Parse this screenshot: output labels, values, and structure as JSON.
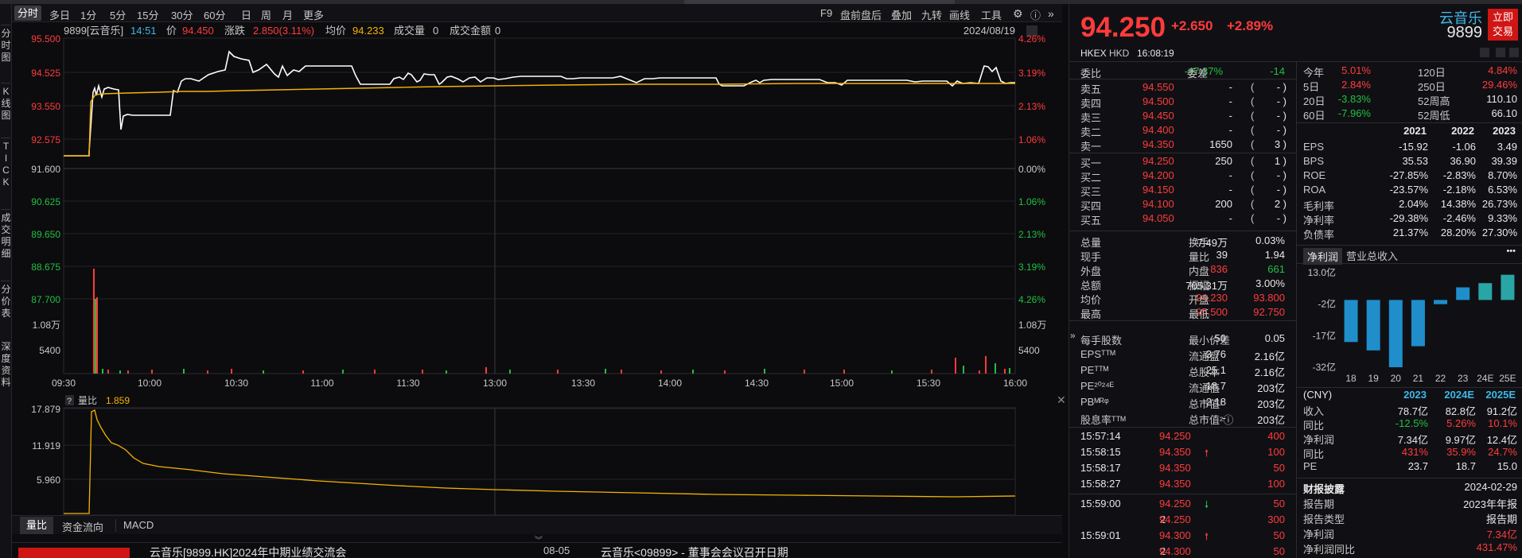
{
  "toolbar": {
    "timeframes": [
      "分时",
      "多日",
      "1分",
      "5分",
      "15分",
      "30分",
      "60分",
      "日",
      "周",
      "月",
      "更多"
    ],
    "right_items": [
      "F9",
      "盘前盘后",
      "叠加",
      "九转",
      "画线",
      "工具"
    ]
  },
  "left_tabs": [
    "分时图",
    "K线图",
    "TICK",
    "成交明细",
    "分价表",
    "深度资料"
  ],
  "chart": {
    "header": {
      "code": "9899[云音乐]",
      "time": "14:51",
      "price_label": "价",
      "price": "94.450",
      "chg_label": "涨跌",
      "chg": "2.850(3.11%)",
      "avg_label": "均价",
      "avg": "94.233",
      "vol_label": "成交量",
      "vol": "0",
      "amt_label": "成交金额",
      "amt": "0",
      "date": "2024/08/19"
    },
    "price_ticks": [
      "95.500",
      "94.525",
      "93.550",
      "92.575",
      "91.600",
      "90.625",
      "89.650",
      "88.675",
      "87.700"
    ],
    "pct_ticks": [
      "4.26%",
      "3.19%",
      "2.13%",
      "1.06%",
      "0.00%",
      "1.06%",
      "2.13%",
      "3.19%",
      "4.26%"
    ],
    "vol_ticks": [
      "1.08万",
      "5400"
    ],
    "time_ticks": [
      "09:30",
      "10:00",
      "10:30",
      "11:00",
      "11:30",
      "13:00",
      "13:30",
      "14:00",
      "14:30",
      "15:00",
      "15:30",
      "16:00"
    ]
  },
  "sub_chart": {
    "label": "量比",
    "value": "1.859",
    "ticks": [
      "17.879",
      "11.919",
      "5.960"
    ]
  },
  "bottom_tabs": [
    "量比",
    "资金流向",
    "MACD"
  ],
  "news": [
    "云音乐[9899.HK]2024年中期业绩交流会",
    "08-05",
    "云音乐<09899> - 董事会会议召开日期"
  ],
  "quote": {
    "name": "云音乐",
    "code": "9899",
    "price": "94.250",
    "change": "+2.650",
    "pct": "+2.89%",
    "exchange": "HKEX",
    "currency": "HKD",
    "time": "16:08:19",
    "trade_button": "立即交易"
  },
  "orderbook": {
    "ratio_label": "委比",
    "ratio": "-47.37%",
    "diff_label": "委差",
    "diff": "-14",
    "asks": [
      {
        "label": "卖五",
        "price": "94.550",
        "vol": "-",
        "n": "-"
      },
      {
        "label": "卖四",
        "price": "94.500",
        "vol": "-",
        "n": "-"
      },
      {
        "label": "卖三",
        "price": "94.450",
        "vol": "-",
        "n": "-"
      },
      {
        "label": "卖二",
        "price": "94.400",
        "vol": "-",
        "n": "-"
      },
      {
        "label": "卖一",
        "price": "94.350",
        "vol": "1650",
        "n": "3"
      }
    ],
    "bids": [
      {
        "label": "买一",
        "price": "94.250",
        "vol": "250",
        "n": "1"
      },
      {
        "label": "买二",
        "price": "94.200",
        "vol": "-",
        "n": "-"
      },
      {
        "label": "买三",
        "price": "94.150",
        "vol": "-",
        "n": "-"
      },
      {
        "label": "买四",
        "price": "94.100",
        "vol": "200",
        "n": "2"
      },
      {
        "label": "买五",
        "price": "94.050",
        "vol": "-",
        "n": "-"
      }
    ]
  },
  "stats": [
    {
      "l1": "总量",
      "v1": "7.49万",
      "c1": "wt",
      "l2": "换手",
      "v2": "0.03%",
      "c2": "wt"
    },
    {
      "l1": "现手",
      "v1": "39",
      "c1": "wt",
      "l2": "量比",
      "v2": "1.94",
      "c2": "wt"
    },
    {
      "l1": "外盘",
      "v1": "836",
      "c1": "up",
      "l2": "内盘",
      "v2": "661",
      "c2": "dn"
    },
    {
      "l1": "总额",
      "v1": "705.31万",
      "c1": "wt",
      "l2": "振幅",
      "v2": "3.00%",
      "c2": "wt"
    },
    {
      "l1": "均价",
      "v1": "94.230",
      "c1": "up",
      "l2": "开盘",
      "v2": "93.800",
      "c2": "up"
    },
    {
      "l1": "最高",
      "v1": "95.500",
      "c1": "up",
      "l2": "最低",
      "v2": "92.750",
      "c2": "up"
    }
  ],
  "stats2": [
    {
      "l1": "每手股数",
      "v1": "50",
      "l2": "最小价差",
      "v2": "0.05"
    },
    {
      "l1": "EPSᵀᵀᴹ",
      "v1": "3.76",
      "l2": "流通盘",
      "v2": "2.16亿"
    },
    {
      "l1": "PEᵀᵀᴹ",
      "v1": "25.1",
      "l2": "总股本",
      "v2": "2.16亿"
    },
    {
      "l1": "PE²⁰²⁴ᴱ",
      "v1": "18.7",
      "l2": "流通值",
      "v2": "203亿"
    },
    {
      "l1": "PBᴹᴿᵠ",
      "v1": "2.18",
      "l2": "总市值¹",
      "v2": "203亿"
    },
    {
      "l1": "股息率ᵀᵀᴹ",
      "v1": "-",
      "l2": "总市值²ⓘ",
      "v2": "203亿"
    }
  ],
  "ticks": [
    {
      "t": "15:57:14",
      "p": "94.250",
      "arrow": "",
      "v": "400"
    },
    {
      "t": "15:58:15",
      "p": "94.350",
      "arrow": "up",
      "v": "100"
    },
    {
      "t": "15:58:17",
      "p": "94.350",
      "arrow": "",
      "v": "50"
    },
    {
      "t": "15:58:27",
      "p": "94.350",
      "arrow": "",
      "v": "100"
    },
    {
      "t": "15:59:00",
      "p": "94.250",
      "arrow": "dn",
      "v": "50"
    },
    {
      "t": "2",
      "p": "94.250",
      "arrow": "",
      "v": "300"
    },
    {
      "t": "15:59:01",
      "p": "94.300",
      "arrow": "up",
      "v": "50"
    },
    {
      "t": "2",
      "p": "94.300",
      "arrow": "",
      "v": "50"
    }
  ],
  "perf": [
    {
      "l1": "今年",
      "v1": "5.01%",
      "c1": "up",
      "l2": "120日",
      "v2": "4.84%",
      "c2": "up"
    },
    {
      "l1": "5日",
      "v1": "2.84%",
      "c1": "up",
      "l2": "250日",
      "v2": "29.46%",
      "c2": "up"
    },
    {
      "l1": "20日",
      "v1": "-3.83%",
      "c1": "dn",
      "l2": "52周高",
      "v2": "110.10",
      "c2": "wt"
    },
    {
      "l1": "60日",
      "v1": "-7.96%",
      "c1": "dn",
      "l2": "52周低",
      "v2": "66.10",
      "c2": "wt"
    }
  ],
  "fin_years": [
    "2021",
    "2022",
    "2023"
  ],
  "fin_rows": [
    {
      "l": "EPS",
      "v": [
        "-15.92",
        "-1.06",
        "3.49"
      ]
    },
    {
      "l": "BPS",
      "v": [
        "35.53",
        "36.90",
        "39.39"
      ]
    },
    {
      "l": "ROE",
      "v": [
        "-27.85%",
        "-2.83%",
        "8.70%"
      ]
    },
    {
      "l": "ROA",
      "v": [
        "-23.57%",
        "-2.18%",
        "6.53%"
      ]
    },
    {
      "l": "毛利率",
      "v": [
        "2.04%",
        "14.38%",
        "26.73%"
      ]
    },
    {
      "l": "净利率",
      "v": [
        "-29.38%",
        "-2.46%",
        "9.33%"
      ]
    },
    {
      "l": "负债率",
      "v": [
        "21.37%",
        "28.20%",
        "27.30%"
      ]
    }
  ],
  "profit_tabs": [
    "净利润",
    "营业总收入"
  ],
  "chart_data": {
    "type": "bar",
    "categories": [
      "18",
      "19",
      "20",
      "21",
      "22",
      "23",
      "24E",
      "25E"
    ],
    "values": [
      -20,
      -24,
      -32,
      -22,
      -2,
      6,
      8,
      12
    ],
    "yticks": [
      "13.0亿",
      "-2亿",
      "-17亿",
      "-32亿"
    ],
    "ylim": [
      -32,
      13
    ]
  },
  "forecast": {
    "currency": "(CNY)",
    "years": [
      "2023",
      "2024E",
      "2025E"
    ],
    "rows": [
      {
        "l": "收入",
        "v": [
          "78.7亿",
          "82.8亿",
          "91.2亿"
        ],
        "c": [
          "wt",
          "wt",
          "wt"
        ]
      },
      {
        "l": "同比",
        "v": [
          "-12.5%",
          "5.26%",
          "10.1%"
        ],
        "c": [
          "dn",
          "up",
          "up"
        ]
      },
      {
        "l": "净利润",
        "v": [
          "7.34亿",
          "9.97亿",
          "12.4亿"
        ],
        "c": [
          "wt",
          "wt",
          "wt"
        ]
      },
      {
        "l": "同比",
        "v": [
          "431%",
          "35.9%",
          "24.7%"
        ],
        "c": [
          "up",
          "up",
          "up"
        ]
      },
      {
        "l": "PE",
        "v": [
          "23.7",
          "18.7",
          "15.0"
        ],
        "c": [
          "wt",
          "wt",
          "wt"
        ]
      }
    ]
  },
  "report": {
    "title": "财报披露",
    "date": "2024-02-29",
    "rows": [
      {
        "l": "报告期",
        "v": "2023年年报",
        "c": "wt"
      },
      {
        "l": "报告类型",
        "v": "报告期",
        "c": "wt"
      },
      {
        "l": "净利润",
        "v": "7.34亿",
        "c": "up"
      },
      {
        "l": "净利润同比",
        "v": "431.47%",
        "c": "up"
      }
    ]
  }
}
